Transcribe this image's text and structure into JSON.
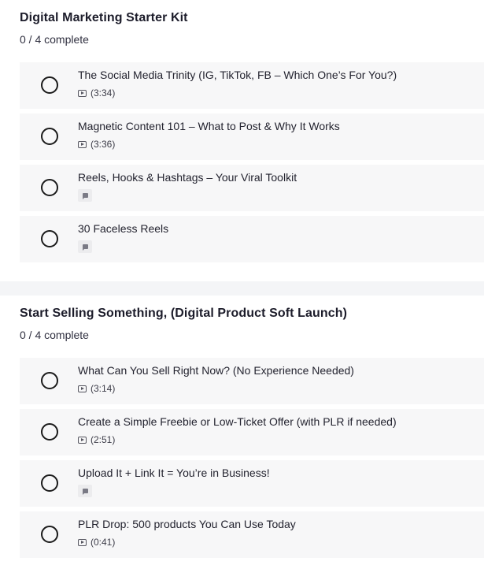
{
  "sections": [
    {
      "title": "Digital Marketing Starter Kit",
      "progress": "0 / 4 complete",
      "lessons": [
        {
          "title": "The Social Media Trinity (IG, TikTok, FB – Which One’s For You?)",
          "type": "video",
          "duration": "(3:34)"
        },
        {
          "title": "Magnetic Content 101 – What to Post & Why It Works",
          "type": "video",
          "duration": "(3:36)"
        },
        {
          "title": "Reels, Hooks & Hashtags – Your Viral Toolkit",
          "type": "text"
        },
        {
          "title": "30 Faceless Reels",
          "type": "text"
        }
      ]
    },
    {
      "title": "Start Selling Something, (Digital Product Soft Launch)",
      "progress": "0 / 4 complete",
      "lessons": [
        {
          "title": "What Can You Sell Right Now? (No Experience Needed)",
          "type": "video",
          "duration": "(3:14)"
        },
        {
          "title": "Create a Simple Freebie or Low-Ticket Offer (with PLR if needed)",
          "type": "video",
          "duration": "(2:51)"
        },
        {
          "title": "Upload It + Link It = You’re in Business!",
          "type": "text"
        },
        {
          "title": "PLR Drop: 500 products You Can Use Today",
          "type": "video",
          "duration": "(0:41)"
        }
      ]
    }
  ]
}
